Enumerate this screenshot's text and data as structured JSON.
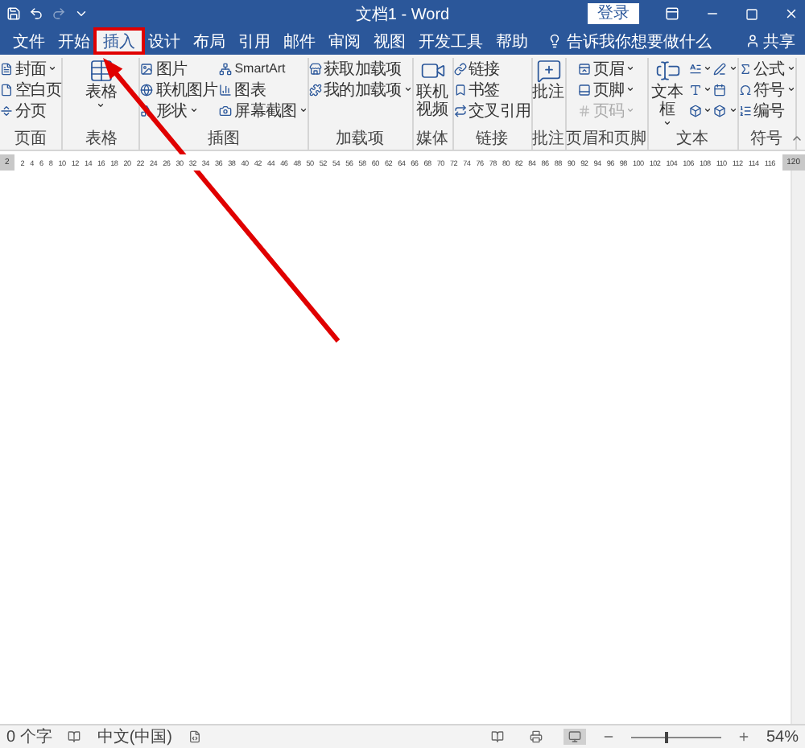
{
  "quick_access": [
    {
      "kind": "save",
      "disabled": false
    },
    {
      "kind": "undo",
      "disabled": false
    },
    {
      "kind": "redo",
      "disabled": true
    },
    {
      "kind": "customize",
      "disabled": false
    }
  ],
  "window": {
    "title": "文档1 - Word",
    "sign_in": "登录"
  },
  "tabs": [
    {
      "label": "文件",
      "selected": false
    },
    {
      "label": "开始",
      "selected": false
    },
    {
      "label": "插入",
      "selected": true
    },
    {
      "label": "设计",
      "selected": false
    },
    {
      "label": "布局",
      "selected": false
    },
    {
      "label": "引用",
      "selected": false
    },
    {
      "label": "邮件",
      "selected": false
    },
    {
      "label": "审阅",
      "selected": false
    },
    {
      "label": "视图",
      "selected": false
    },
    {
      "label": "开发工具",
      "selected": false
    },
    {
      "label": "帮助",
      "selected": false
    }
  ],
  "tell_me": "告诉我你想要做什么",
  "share": "共享",
  "ribbon_groups": [
    {
      "label": "页面",
      "columns": [
        {
          "kind": "stack",
          "items": [
            {
              "label": "封面",
              "dropdown": true
            },
            {
              "label": "空白页",
              "dropdown": false
            },
            {
              "label": "分页",
              "dropdown": false
            }
          ]
        }
      ]
    },
    {
      "label": "表格",
      "columns": [
        {
          "kind": "large",
          "items": [
            {
              "label": "表格",
              "dropdown": true
            }
          ]
        }
      ]
    },
    {
      "label": "插图",
      "columns": [
        {
          "kind": "stack",
          "items": [
            {
              "label": "图片",
              "dropdown": false
            },
            {
              "label": "联机图片",
              "dropdown": false
            },
            {
              "label": "形状",
              "dropdown": true
            }
          ]
        },
        {
          "kind": "stack",
          "items": [
            {
              "label": "SmartArt",
              "dropdown": false
            },
            {
              "label": "图表",
              "dropdown": false
            },
            {
              "label": "屏幕截图",
              "dropdown": true
            }
          ]
        }
      ]
    },
    {
      "label": "加载项",
      "columns": [
        {
          "kind": "stack",
          "items": [
            {
              "label": "获取加载项",
              "dropdown": false
            },
            {
              "label": "我的加载项",
              "dropdown": true
            }
          ]
        }
      ]
    },
    {
      "label": "媒体",
      "columns": [
        {
          "kind": "large",
          "items": [
            {
              "label": "联机视频",
              "dropdown": false
            }
          ]
        }
      ]
    },
    {
      "label": "链接",
      "columns": [
        {
          "kind": "stack",
          "items": [
            {
              "label": "链接",
              "dropdown": false
            },
            {
              "label": "书签",
              "dropdown": false
            },
            {
              "label": "交叉引用",
              "dropdown": false
            }
          ]
        }
      ]
    },
    {
      "label": "批注",
      "columns": [
        {
          "kind": "large",
          "items": [
            {
              "label": "批注",
              "dropdown": false
            }
          ]
        }
      ]
    },
    {
      "label": "页眉和页脚",
      "columns": [
        {
          "kind": "stack",
          "items": [
            {
              "label": "页眉",
              "dropdown": true,
              "disabled": false
            },
            {
              "label": "页脚",
              "dropdown": true,
              "disabled": false
            },
            {
              "label": "页码",
              "dropdown": true,
              "disabled": true
            }
          ]
        }
      ]
    },
    {
      "label": "文本",
      "columns": [
        {
          "kind": "large",
          "items": [
            {
              "label": "文本框",
              "dropdown": true
            }
          ]
        },
        {
          "kind": "stack",
          "items": [
            {
              "dropdown": true
            },
            {
              "dropdown": true
            },
            {
              "dropdown": true
            }
          ]
        },
        {
          "kind": "stack",
          "items": [
            {
              "dropdown": true
            },
            {
              "dropdown": false
            },
            {
              "dropdown": true
            }
          ]
        }
      ]
    },
    {
      "label": "符号",
      "columns": [
        {
          "kind": "stack",
          "items": [
            {
              "label": "公式",
              "dropdown": true
            },
            {
              "label": "符号",
              "dropdown": true
            },
            {
              "label": "编号",
              "dropdown": false
            }
          ]
        }
      ]
    }
  ],
  "ruler": {
    "left_label": "2",
    "ticks": [
      "2",
      "4",
      "6",
      "8",
      "10",
      "12",
      "14",
      "16",
      "18",
      "20",
      "22",
      "24",
      "26",
      "30",
      "32",
      "34",
      "36",
      "38",
      "40",
      "42",
      "44",
      "46",
      "48",
      "50",
      "52",
      "54",
      "56",
      "58",
      "60",
      "62",
      "64",
      "66",
      "68",
      "70",
      "72",
      "74",
      "76",
      "78",
      "80",
      "82",
      "84",
      "86",
      "88",
      "90",
      "92",
      "94",
      "96",
      "98",
      "100",
      "102",
      "104",
      "106",
      "108",
      "110",
      "112",
      "114",
      "116"
    ],
    "right_label": "120"
  },
  "status_bar": {
    "word_count": "0 个字",
    "language": "中文(中国)",
    "views": [
      {
        "selected": false
      },
      {
        "selected": false
      },
      {
        "selected": true
      }
    ],
    "zoom": {
      "level": 0.4,
      "reading": "54%"
    }
  }
}
